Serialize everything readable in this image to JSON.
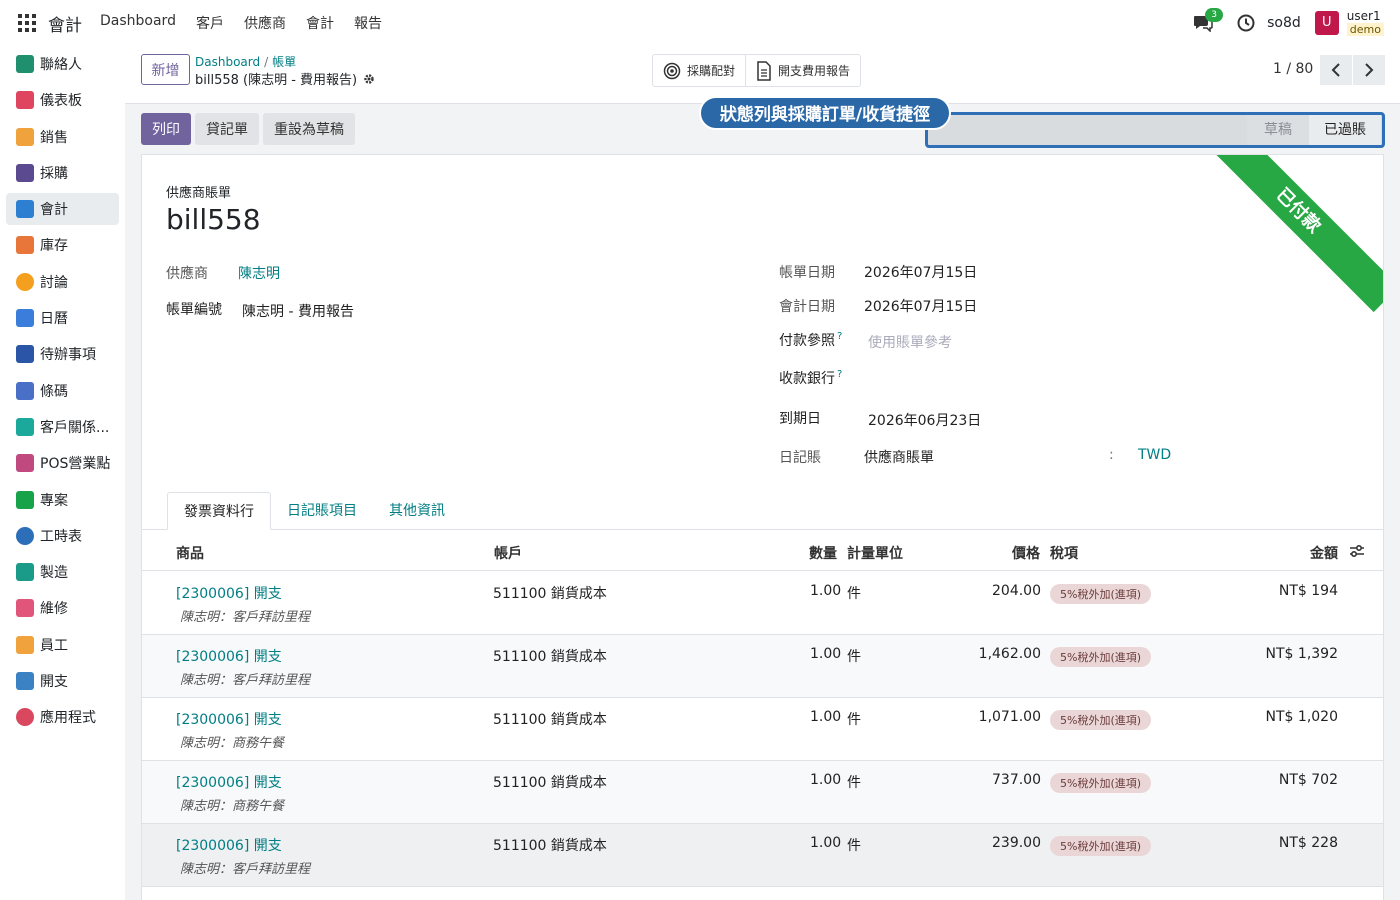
{
  "topbar": {
    "brand": "會計",
    "menu": [
      "Dashboard",
      "客戶",
      "供應商",
      "會計",
      "報告"
    ],
    "chat_count": "3",
    "db_name": "so8d",
    "avatar_letter": "U",
    "user_name": "user1",
    "user_db": "demo"
  },
  "sidebar": {
    "items": [
      {
        "label": "聯絡人",
        "color": "#1f8f6e"
      },
      {
        "label": "儀表板",
        "color": "#e0455f"
      },
      {
        "label": "銷售",
        "color": "#f0a33c"
      },
      {
        "label": "採購",
        "color": "#5b4a8f"
      },
      {
        "label": "會計",
        "color": "#2c7fd1",
        "active": true
      },
      {
        "label": "庫存",
        "color": "#e8753a"
      },
      {
        "label": "討論",
        "color": "#f59f1e"
      },
      {
        "label": "日曆",
        "color": "#3b7ddb"
      },
      {
        "label": "待辦事項",
        "color": "#2b56a8"
      },
      {
        "label": "條碼",
        "color": "#4a6fc7"
      },
      {
        "label": "客戶關係...",
        "color": "#1aa99a"
      },
      {
        "label": "POS營業點",
        "color": "#c04a7f"
      },
      {
        "label": "專案",
        "color": "#16a34a"
      },
      {
        "label": "工時表",
        "color": "#2c6fb8"
      },
      {
        "label": "製造",
        "color": "#1a9b8a"
      },
      {
        "label": "維修",
        "color": "#e2557a"
      },
      {
        "label": "員工",
        "color": "#f0a33c"
      },
      {
        "label": "開支",
        "color": "#3b82c4"
      },
      {
        "label": "應用程式",
        "color": "#d9485f"
      }
    ]
  },
  "control_panel": {
    "new_label": "新增",
    "breadcrumb_parent": "Dashboard",
    "breadcrumb_child": "帳單",
    "current_record": "bill558 (陳志明 - 費用報告)",
    "smart_buttons": [
      "採購配對",
      "開支費用報告"
    ],
    "pager": "1 / 80"
  },
  "actions": {
    "print": "列印",
    "credit_note": "貸記單",
    "reset_draft": "重設為草稿"
  },
  "status": {
    "draft": "草稿",
    "posted": "已過賬",
    "annotation": "狀態列與採購訂單/收貨捷徑"
  },
  "sheet": {
    "ribbon": "已付款",
    "doc_type": "供應商賬單",
    "doc_name": "bill558",
    "vendor_label": "供應商",
    "vendor_value": "陳志明",
    "ref_label": "帳單編號",
    "ref_value": "陳志明 - 費用報告",
    "bill_date_label": "帳單日期",
    "bill_date_value": "2026年07月15日",
    "acc_date_label": "會計日期",
    "acc_date_value": "2026年07月15日",
    "pay_ref_label": "付款參照",
    "pay_ref_placeholder": "使用賬單參考",
    "bank_label": "收款銀行",
    "due_label": "到期日",
    "due_value": "2026年06月23日",
    "journal_label": "日記賬",
    "journal_value": "供應商賬單",
    "currency_sep": ":",
    "currency_value": "TWD",
    "help_mark": "?"
  },
  "tabs": [
    "發票資料行",
    "日記賬項目",
    "其他資訊"
  ],
  "table": {
    "headers": {
      "product": "商品",
      "account": "帳戶",
      "qty": "數量",
      "uom": "計量單位",
      "price": "價格",
      "tax": "稅項",
      "amount": "金額"
    },
    "rows": [
      {
        "product": "[2300006] 開支",
        "desc": "陳志明：客戶拜訪里程",
        "account": "511100 銷貨成本",
        "qty": "1.00",
        "uom": "件",
        "price": "204.00",
        "tax": "5%稅外加(進項)",
        "amount": "NT$ 194"
      },
      {
        "product": "[2300006] 開支",
        "desc": "陳志明：客戶拜訪里程",
        "account": "511100 銷貨成本",
        "qty": "1.00",
        "uom": "件",
        "price": "1,462.00",
        "tax": "5%稅外加(進項)",
        "amount": "NT$ 1,392"
      },
      {
        "product": "[2300006] 開支",
        "desc": "陳志明：商務午餐",
        "account": "511100 銷貨成本",
        "qty": "1.00",
        "uom": "件",
        "price": "1,071.00",
        "tax": "5%稅外加(進項)",
        "amount": "NT$ 1,020"
      },
      {
        "product": "[2300006] 開支",
        "desc": "陳志明：商務午餐",
        "account": "511100 銷貨成本",
        "qty": "1.00",
        "uom": "件",
        "price": "737.00",
        "tax": "5%稅外加(進項)",
        "amount": "NT$ 702"
      },
      {
        "product": "[2300006] 開支",
        "desc": "陳志明：客戶拜訪里程",
        "account": "511100 銷貨成本",
        "qty": "1.00",
        "uom": "件",
        "price": "239.00",
        "tax": "5%稅外加(進項)",
        "amount": "NT$ 228"
      }
    ]
  }
}
